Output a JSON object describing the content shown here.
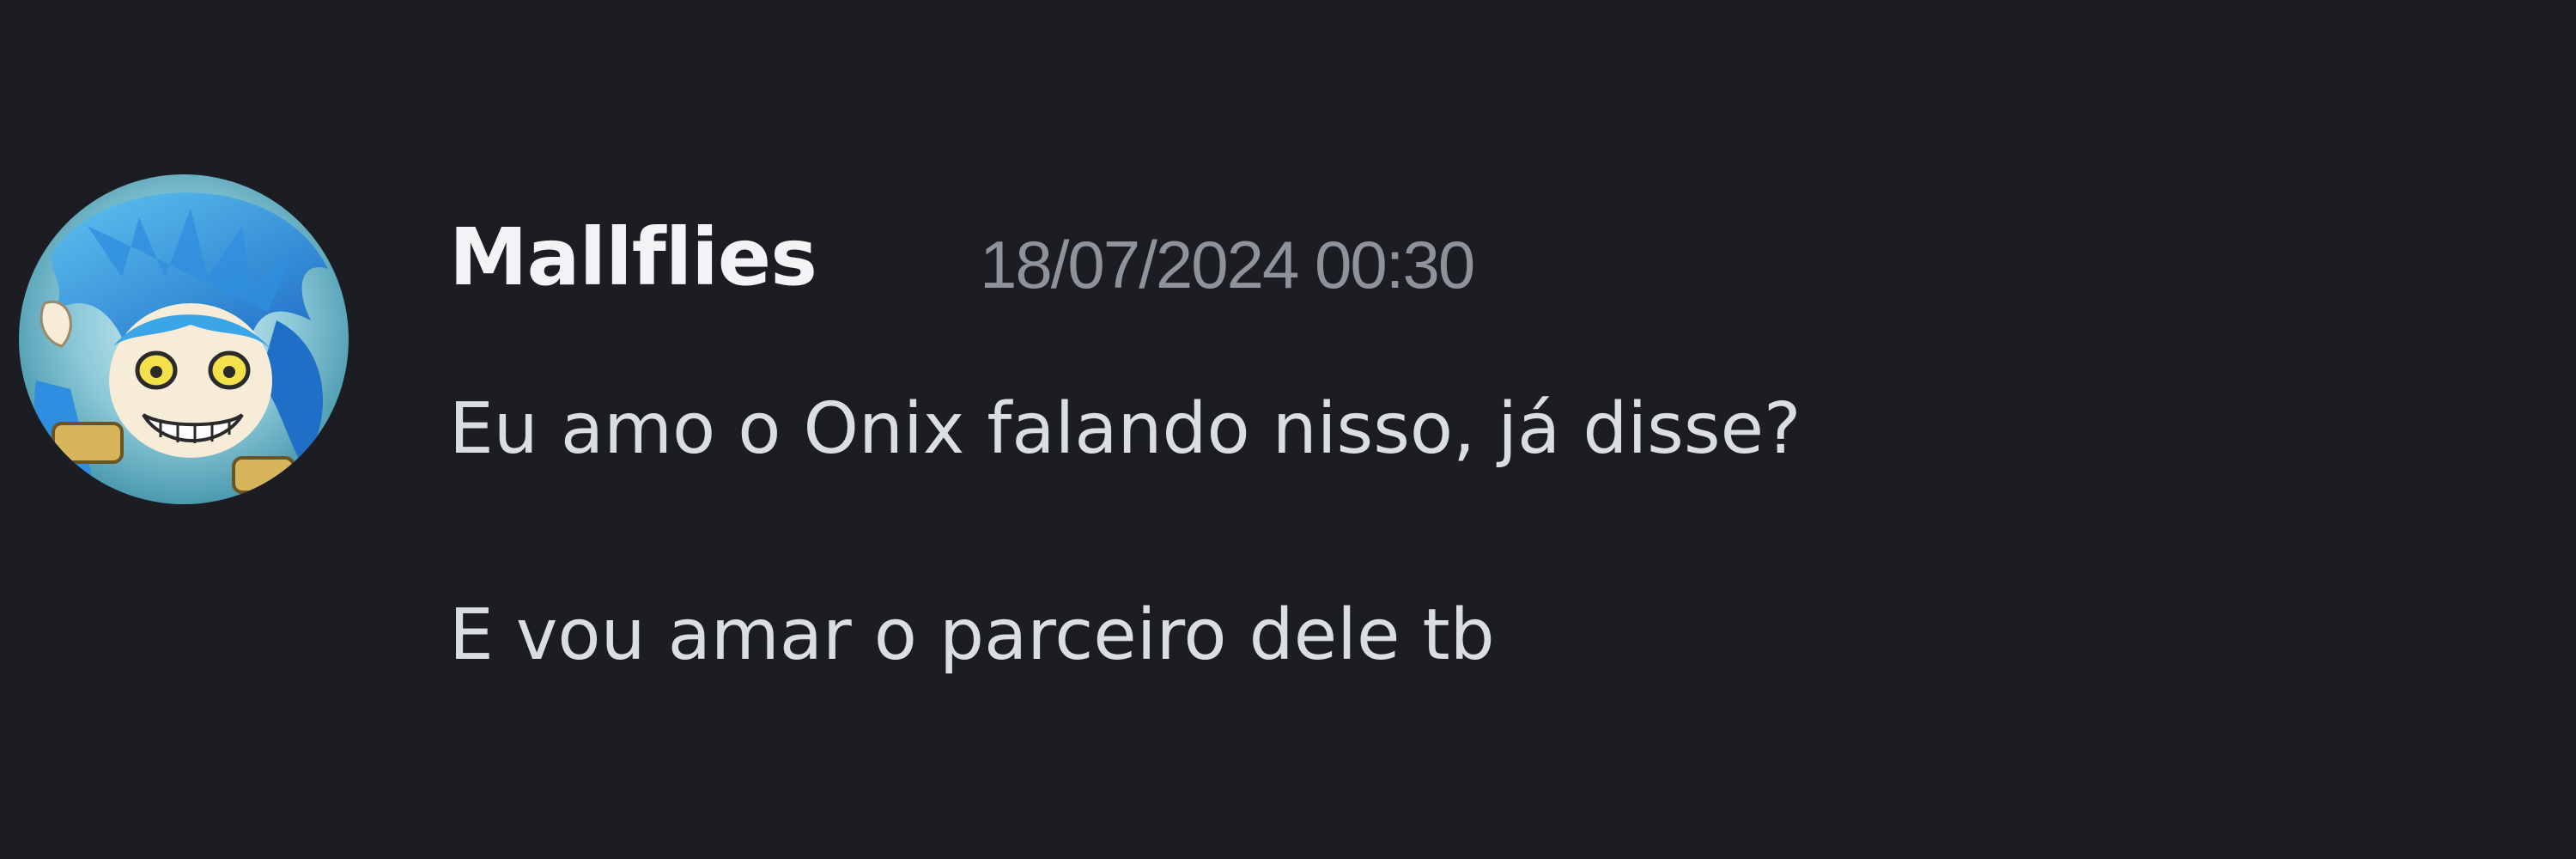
{
  "message": {
    "author": "Mallflies",
    "timestamp": "18/07/2024 00:30",
    "lines": [
      "Eu amo o Onix falando nisso, já disse?",
      "E vou amar o parceiro dele tb"
    ],
    "avatar_icon": "anime-character-avatar-icon"
  },
  "colors": {
    "background": "#1c1d22",
    "author": "#f2f3f5",
    "timestamp": "#8f929b",
    "text": "#dbdee1"
  }
}
